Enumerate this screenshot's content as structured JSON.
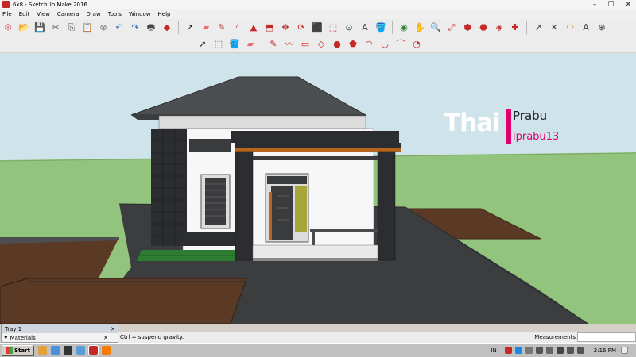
{
  "window": {
    "title": "6x8 - SketchUp Make 2016",
    "controls": [
      "–",
      "☐",
      "✕"
    ]
  },
  "menu": [
    "File",
    "Edit",
    "View",
    "Camera",
    "Draw",
    "Tools",
    "Window",
    "Help"
  ],
  "toolbar1": {
    "groups": [
      [
        {
          "name": "getting-started-icon",
          "glyph": "⚙",
          "color": "#c62828"
        },
        {
          "name": "open-folder-icon",
          "glyph": "📂",
          "color": "#c9a227"
        },
        {
          "name": "save-icon",
          "glyph": "💾",
          "color": "#1565c0"
        },
        {
          "name": "cut-icon",
          "glyph": "✂",
          "color": "#555555"
        },
        {
          "name": "copy-icon",
          "glyph": "⎘",
          "color": "#555555"
        },
        {
          "name": "paste-icon",
          "glyph": "📋",
          "color": "#8d6e63"
        },
        {
          "name": "erase-icon",
          "glyph": "⊗",
          "color": "#777777"
        },
        {
          "name": "undo-icon",
          "glyph": "↶",
          "color": "#1565c0"
        },
        {
          "name": "redo-icon",
          "glyph": "↷",
          "color": "#1565c0"
        },
        {
          "name": "print-icon",
          "glyph": "🖶",
          "color": "#444444"
        },
        {
          "name": "model-info-icon",
          "glyph": "◆",
          "color": "#c62828"
        }
      ],
      [
        {
          "name": "select-icon",
          "glyph": "➚",
          "color": "#222222"
        },
        {
          "name": "eraser-icon",
          "glyph": "▰",
          "color": "#e57373"
        },
        {
          "name": "line-icon",
          "glyph": "✎",
          "color": "#c62828"
        },
        {
          "name": "arc-icon",
          "glyph": "◜",
          "color": "#c62828"
        },
        {
          "name": "shapes-icon",
          "glyph": "▲",
          "color": "#c62828"
        },
        {
          "name": "push-pull-icon",
          "glyph": "⬒",
          "color": "#c62828"
        },
        {
          "name": "move-icon",
          "glyph": "✥",
          "color": "#c62828"
        },
        {
          "name": "rotate-icon",
          "glyph": "⟳",
          "color": "#c62828"
        },
        {
          "name": "scale-icon",
          "glyph": "⬛",
          "color": "#c62828"
        },
        {
          "name": "offset-icon",
          "glyph": "⬚",
          "color": "#c62828"
        },
        {
          "name": "tape-measure-icon",
          "glyph": "⊙",
          "color": "#444444"
        },
        {
          "name": "text-icon",
          "glyph": "A",
          "color": "#444444"
        },
        {
          "name": "paint-bucket-icon",
          "glyph": "🪣",
          "color": "#b8860b"
        }
      ],
      [
        {
          "name": "orbit-icon",
          "glyph": "◉",
          "color": "#2e7d32"
        },
        {
          "name": "pan-icon",
          "glyph": "✋",
          "color": "#8d6e63"
        },
        {
          "name": "zoom-icon",
          "glyph": "🔍",
          "color": "#444444"
        },
        {
          "name": "zoom-extents-icon",
          "glyph": "⤢",
          "color": "#c62828"
        },
        {
          "name": "warehouse-icon",
          "glyph": "⬢",
          "color": "#c62828"
        },
        {
          "name": "share-model-icon",
          "glyph": "⬣",
          "color": "#c62828"
        },
        {
          "name": "components-icon",
          "glyph": "◈",
          "color": "#c62828"
        },
        {
          "name": "extensions-icon",
          "glyph": "✚",
          "color": "#c62828"
        }
      ],
      [
        {
          "name": "dimension-icon",
          "glyph": "↗",
          "color": "#444444"
        },
        {
          "name": "axes-icon",
          "glyph": "✕",
          "color": "#444444"
        },
        {
          "name": "protractor-icon",
          "glyph": "◠",
          "color": "#b8860b"
        },
        {
          "name": "3d-text-icon",
          "glyph": "A",
          "color": "#444444"
        },
        {
          "name": "section-plane-icon",
          "glyph": "⊕",
          "color": "#444444"
        }
      ]
    ]
  },
  "toolbar2": {
    "groups": [
      [
        {
          "name": "select-small-icon",
          "glyph": "➚",
          "color": "#222222"
        },
        {
          "name": "make-component-icon",
          "glyph": "⬚",
          "color": "#555555"
        },
        {
          "name": "paint-small-icon",
          "glyph": "🪣",
          "color": "#b8860b"
        },
        {
          "name": "eraser-small-icon",
          "glyph": "▰",
          "color": "#e57373"
        }
      ],
      [
        {
          "name": "pencil-icon",
          "glyph": "✎",
          "color": "#c62828"
        },
        {
          "name": "freehand-icon",
          "glyph": "〰",
          "color": "#c62828"
        },
        {
          "name": "rectangle-icon",
          "glyph": "▭",
          "color": "#c62828"
        },
        {
          "name": "rotated-rectangle-icon",
          "glyph": "◇",
          "color": "#c62828"
        },
        {
          "name": "circle-icon",
          "glyph": "●",
          "color": "#c62828"
        },
        {
          "name": "polygon-icon",
          "glyph": "⬟",
          "color": "#c62828"
        },
        {
          "name": "arc-small-icon",
          "glyph": "◠",
          "color": "#c62828"
        },
        {
          "name": "2pt-arc-icon",
          "glyph": "◡",
          "color": "#c62828"
        },
        {
          "name": "3pt-arc-icon",
          "glyph": "⌒",
          "color": "#c62828"
        },
        {
          "name": "pie-icon",
          "glyph": "◔",
          "color": "#c62828"
        }
      ]
    ]
  },
  "watermark": {
    "part1": "Thai",
    "part2": "Prabu",
    "part3": "iprabu13",
    "accent": "#e4006c"
  },
  "tray": {
    "title": "Tray 1",
    "close": "✕",
    "section": "Materials",
    "section_close": "✕"
  },
  "status": {
    "hint": "Ctrl = suspend gravity.",
    "measurements_label": "Measurements"
  },
  "taskbar": {
    "start": "Start",
    "lang": "IN",
    "clock": "2:16 PM"
  },
  "colors": {
    "sky": "#cfe3ea",
    "grass": "#93c47d",
    "roof": "#4c4f52",
    "wall": "#f7f7f7",
    "dark_wall": "#2b2d30",
    "path": "#3a3b3d",
    "soil": "#5a3a24",
    "accent_wood": "#b5651d"
  }
}
